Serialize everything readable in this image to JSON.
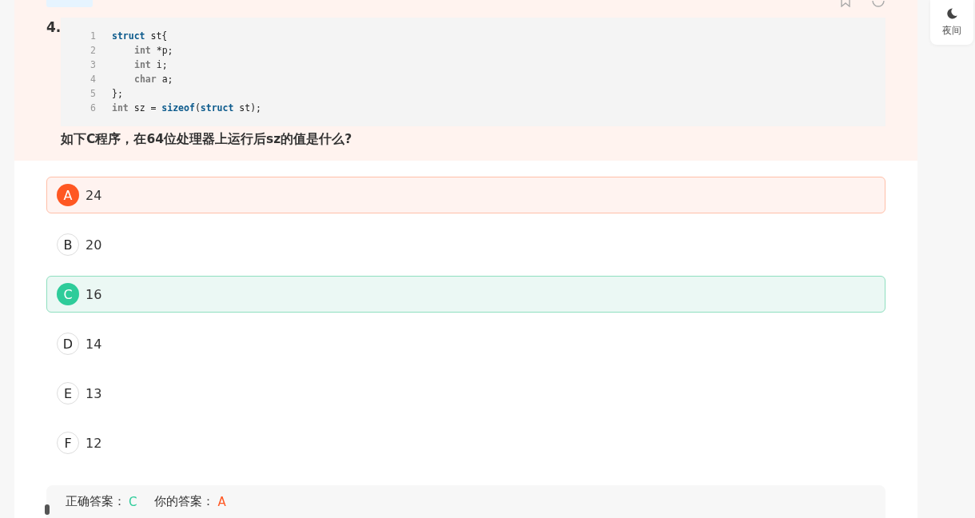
{
  "question": {
    "number": "4.",
    "text": "如下C程序，在64位处理器上运行后sz的值是什么?",
    "code": [
      {
        "number": "1",
        "tokens": [
          {
            "kind": "keyword",
            "text": "struct"
          },
          {
            "kind": "plain",
            "text": " st{"
          }
        ]
      },
      {
        "number": "2",
        "indented": true,
        "tokens": [
          {
            "kind": "type",
            "text": "int"
          },
          {
            "kind": "plain",
            "text": " *p;"
          }
        ]
      },
      {
        "number": "3",
        "indented": true,
        "tokens": [
          {
            "kind": "type",
            "text": "int"
          },
          {
            "kind": "plain",
            "text": " i;"
          }
        ]
      },
      {
        "number": "4",
        "indented": true,
        "tokens": [
          {
            "kind": "type",
            "text": "char"
          },
          {
            "kind": "plain",
            "text": " a;"
          }
        ]
      },
      {
        "number": "5",
        "tokens": [
          {
            "kind": "plain",
            "text": "};"
          }
        ]
      },
      {
        "number": "6",
        "tokens": [
          {
            "kind": "type",
            "text": "int"
          },
          {
            "kind": "plain",
            "text": " sz = "
          },
          {
            "kind": "keyword",
            "text": "sizeof"
          },
          {
            "kind": "plain",
            "text": "("
          },
          {
            "kind": "keyword",
            "text": "struct"
          },
          {
            "kind": "plain",
            "text": " st);"
          }
        ]
      }
    ]
  },
  "options": [
    {
      "letter": "A",
      "text": "24",
      "selected": true,
      "correct": false
    },
    {
      "letter": "B",
      "text": "20",
      "selected": false,
      "correct": false
    },
    {
      "letter": "C",
      "text": "16",
      "selected": false,
      "correct": true
    },
    {
      "letter": "D",
      "text": "14",
      "selected": false,
      "correct": false
    },
    {
      "letter": "E",
      "text": "13",
      "selected": false,
      "correct": false
    },
    {
      "letter": "F",
      "text": "12",
      "selected": false,
      "correct": false
    }
  ],
  "answer": {
    "correct_label": "正确答案：",
    "correct_value": "C",
    "yours_label": "你的答案：",
    "yours_value": "A"
  },
  "night_button": {
    "label": "夜间"
  }
}
